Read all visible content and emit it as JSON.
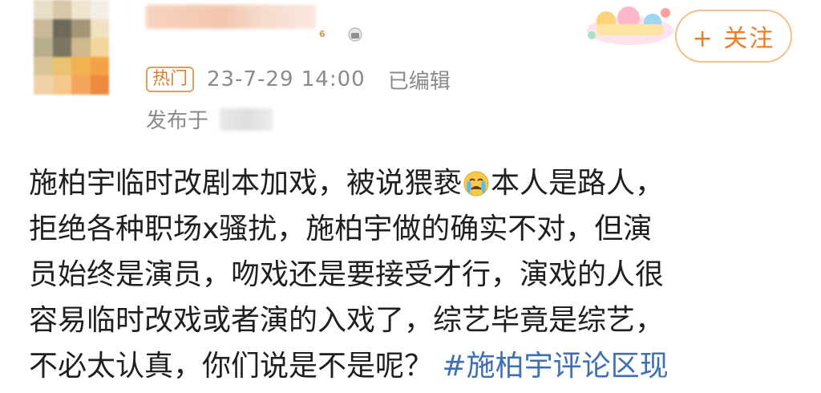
{
  "post": {
    "follow_label": "+ 关注",
    "hot_tag": "热门",
    "timestamp": "23-7-29 14:00",
    "edited": "已编辑",
    "published_prefix": "发布于",
    "level_badge": "6",
    "content_lines": [
      "施柏宇临时改剧本加戏，被说猥亵",
      "本人是路人，",
      "拒绝各种职场x骚扰，施柏宇做的确实不对，但演",
      "员始终是演员，吻戏还是要接受才行，演戏的人很",
      "容易临时改戏或者演的入戏了，综艺毕竟是综艺，",
      "不必太认真，你们说是不是呢？"
    ],
    "hashtag": "#施柏宇评论区现",
    "emoji": "crying-face-icon"
  },
  "colors": {
    "follow_text": "#f17b20",
    "follow_border": "#f1c18d",
    "hot_tag": "#d9802f",
    "meta_text": "#8a8a8a",
    "body_text": "#1f1f1f",
    "hashtag": "#3d6fb4"
  }
}
